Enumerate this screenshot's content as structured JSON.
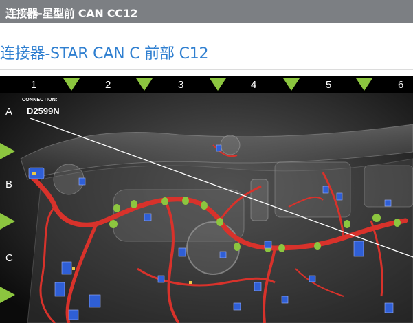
{
  "header": {
    "title": "连接器-星型前 CAN CC12"
  },
  "page": {
    "title": "连接器-STAR CAN C 前部 C12"
  },
  "diagram": {
    "columns": [
      "1",
      "2",
      "3",
      "4",
      "5",
      "6"
    ],
    "rows": [
      "A",
      "B",
      "C"
    ],
    "connection_label": "CONNECTION:",
    "connection_id": "D2599N"
  },
  "colors": {
    "accent_blue": "#2f7fd0",
    "marker_green": "#8cc63f",
    "harness_red": "#d8322b"
  }
}
